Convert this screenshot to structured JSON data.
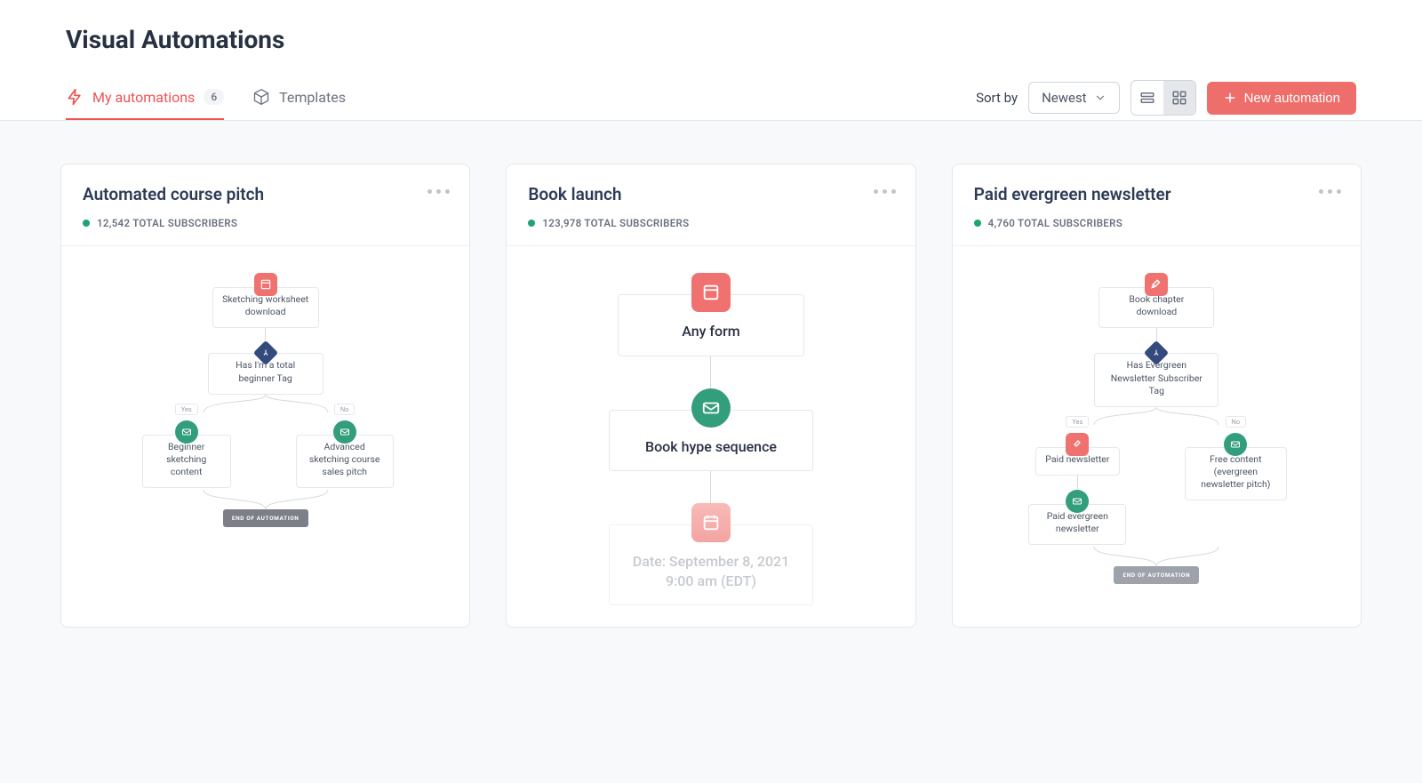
{
  "page_title": "Visual Automations",
  "tabs": {
    "my_automations": {
      "label": "My automations",
      "count": "6"
    },
    "templates": {
      "label": "Templates"
    }
  },
  "sort": {
    "label": "Sort by",
    "value": "Newest"
  },
  "new_button": "New automation",
  "cards": [
    {
      "title": "Automated course pitch",
      "subscribers": "12,542 TOTAL SUBSCRIBERS",
      "flow": {
        "entry": "Sketching worksheet download",
        "condition": "Has I'm a total beginner Tag",
        "yes_label": "Yes",
        "no_label": "No",
        "yes_action": "Beginner sketching content",
        "no_action": "Advanced sketching course sales pitch",
        "end": "END OF AUTOMATION"
      }
    },
    {
      "title": "Book launch",
      "subscribers": "123,978 TOTAL SUBSCRIBERS",
      "flow": {
        "entry": "Any form",
        "action": "Book hype sequence",
        "event": "Date: September 8, 2021 9:00 am (EDT)"
      }
    },
    {
      "title": "Paid evergreen newsletter",
      "subscribers": "4,760 TOTAL SUBSCRIBERS",
      "flow": {
        "entry": "Book chapter download",
        "condition": "Has Evergreen Newsletter Subscriber Tag",
        "yes_label": "Yes",
        "no_label": "No",
        "yes_action": "Paid newsletter",
        "no_action": "Free content (evergreen newsletter pitch)",
        "followup": "Paid evergreen newsletter",
        "end": "END OF AUTOMATION"
      }
    }
  ]
}
